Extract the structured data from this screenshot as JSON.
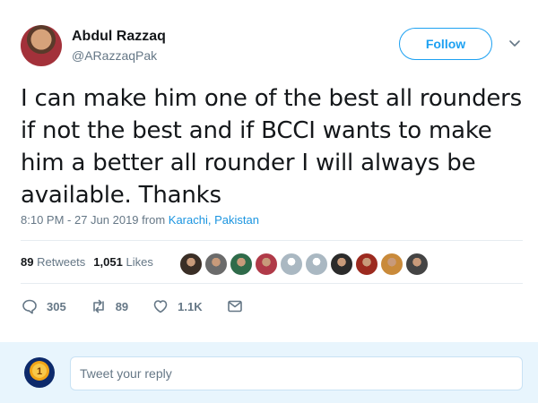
{
  "author": {
    "name": "Abdul Razzaq",
    "handle": "@ARazzaqPak"
  },
  "follow_label": "Follow",
  "tweet": {
    "text": "I can make him one of the best all rounders if not the best and if BCCI wants to make him a better all rounder I will always be available. Thanks",
    "time": "8:10 PM - 27 Jun 2019",
    "from_word": "from",
    "place": "Karachi, Pakistan"
  },
  "stats": {
    "retweets_count": "89",
    "retweets_label": "Retweets",
    "likes_count": "1,051",
    "likes_label": "Likes"
  },
  "likers": [
    {
      "icon": "liker-avatar",
      "color": "#3a2e26"
    },
    {
      "icon": "liker-avatar",
      "color": "#6b6b6b"
    },
    {
      "icon": "liker-avatar",
      "color": "#2f6b4a"
    },
    {
      "icon": "liker-avatar",
      "color": "#b03a48"
    },
    {
      "icon": "default-avatar",
      "color": "#aab8c2"
    },
    {
      "icon": "default-avatar",
      "color": "#aab8c2"
    },
    {
      "icon": "liker-avatar",
      "color": "#2b2b2b"
    },
    {
      "icon": "liker-avatar",
      "color": "#9c2a1f"
    },
    {
      "icon": "liker-avatar",
      "color": "#c98a3a"
    },
    {
      "icon": "liker-avatar",
      "color": "#444444"
    }
  ],
  "actions": {
    "replies": "305",
    "retweets": "89",
    "likes": "1.1K"
  },
  "reply": {
    "placeholder": "Tweet your reply"
  },
  "colors": {
    "accent": "#1da1f2",
    "link": "#1b95e0",
    "muted": "#657786",
    "reply_bg": "#e8f5fd"
  }
}
